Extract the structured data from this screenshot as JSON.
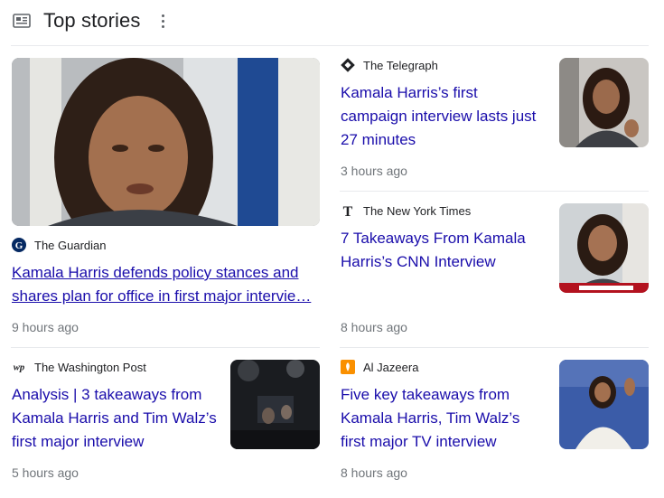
{
  "header": {
    "title": "Top stories"
  },
  "stories": [
    {
      "source": "The Guardian",
      "headline_line1": "Kamala Harris defends policy stances and",
      "headline_line2": "shares plan for office in first major intervie…",
      "time": "9 hours ago"
    },
    {
      "source": "The Telegraph",
      "headline": "Kamala Harris’s first campaign interview lasts just 27 minutes",
      "time": "3 hours ago"
    },
    {
      "source": "The New York Times",
      "headline": "7 Takeaways From Kamala Harris’s CNN Interview",
      "time": "8 hours ago"
    },
    {
      "source": "The Washington Post",
      "headline": "Analysis | 3 takeaways from Kamala Harris and Tim Walz’s first major interview",
      "time": "5 hours ago"
    },
    {
      "source": "Al Jazeera",
      "headline": "Five key takeaways from Kamala Harris, Tim Walz’s first major TV interview",
      "time": "8 hours ago"
    }
  ],
  "icons": {
    "header": "newspaper-icon",
    "menu": "more-vert-icon",
    "guardian": "guardian-logo-icon",
    "telegraph": "telegraph-logo-icon",
    "nyt": "nyt-logo-icon",
    "wapo": "wapo-logo-icon",
    "aljazeera": "aljazeera-logo-icon"
  },
  "colors": {
    "link": "#1a0dab",
    "meta": "#70757a",
    "divider": "#e8eaed"
  }
}
